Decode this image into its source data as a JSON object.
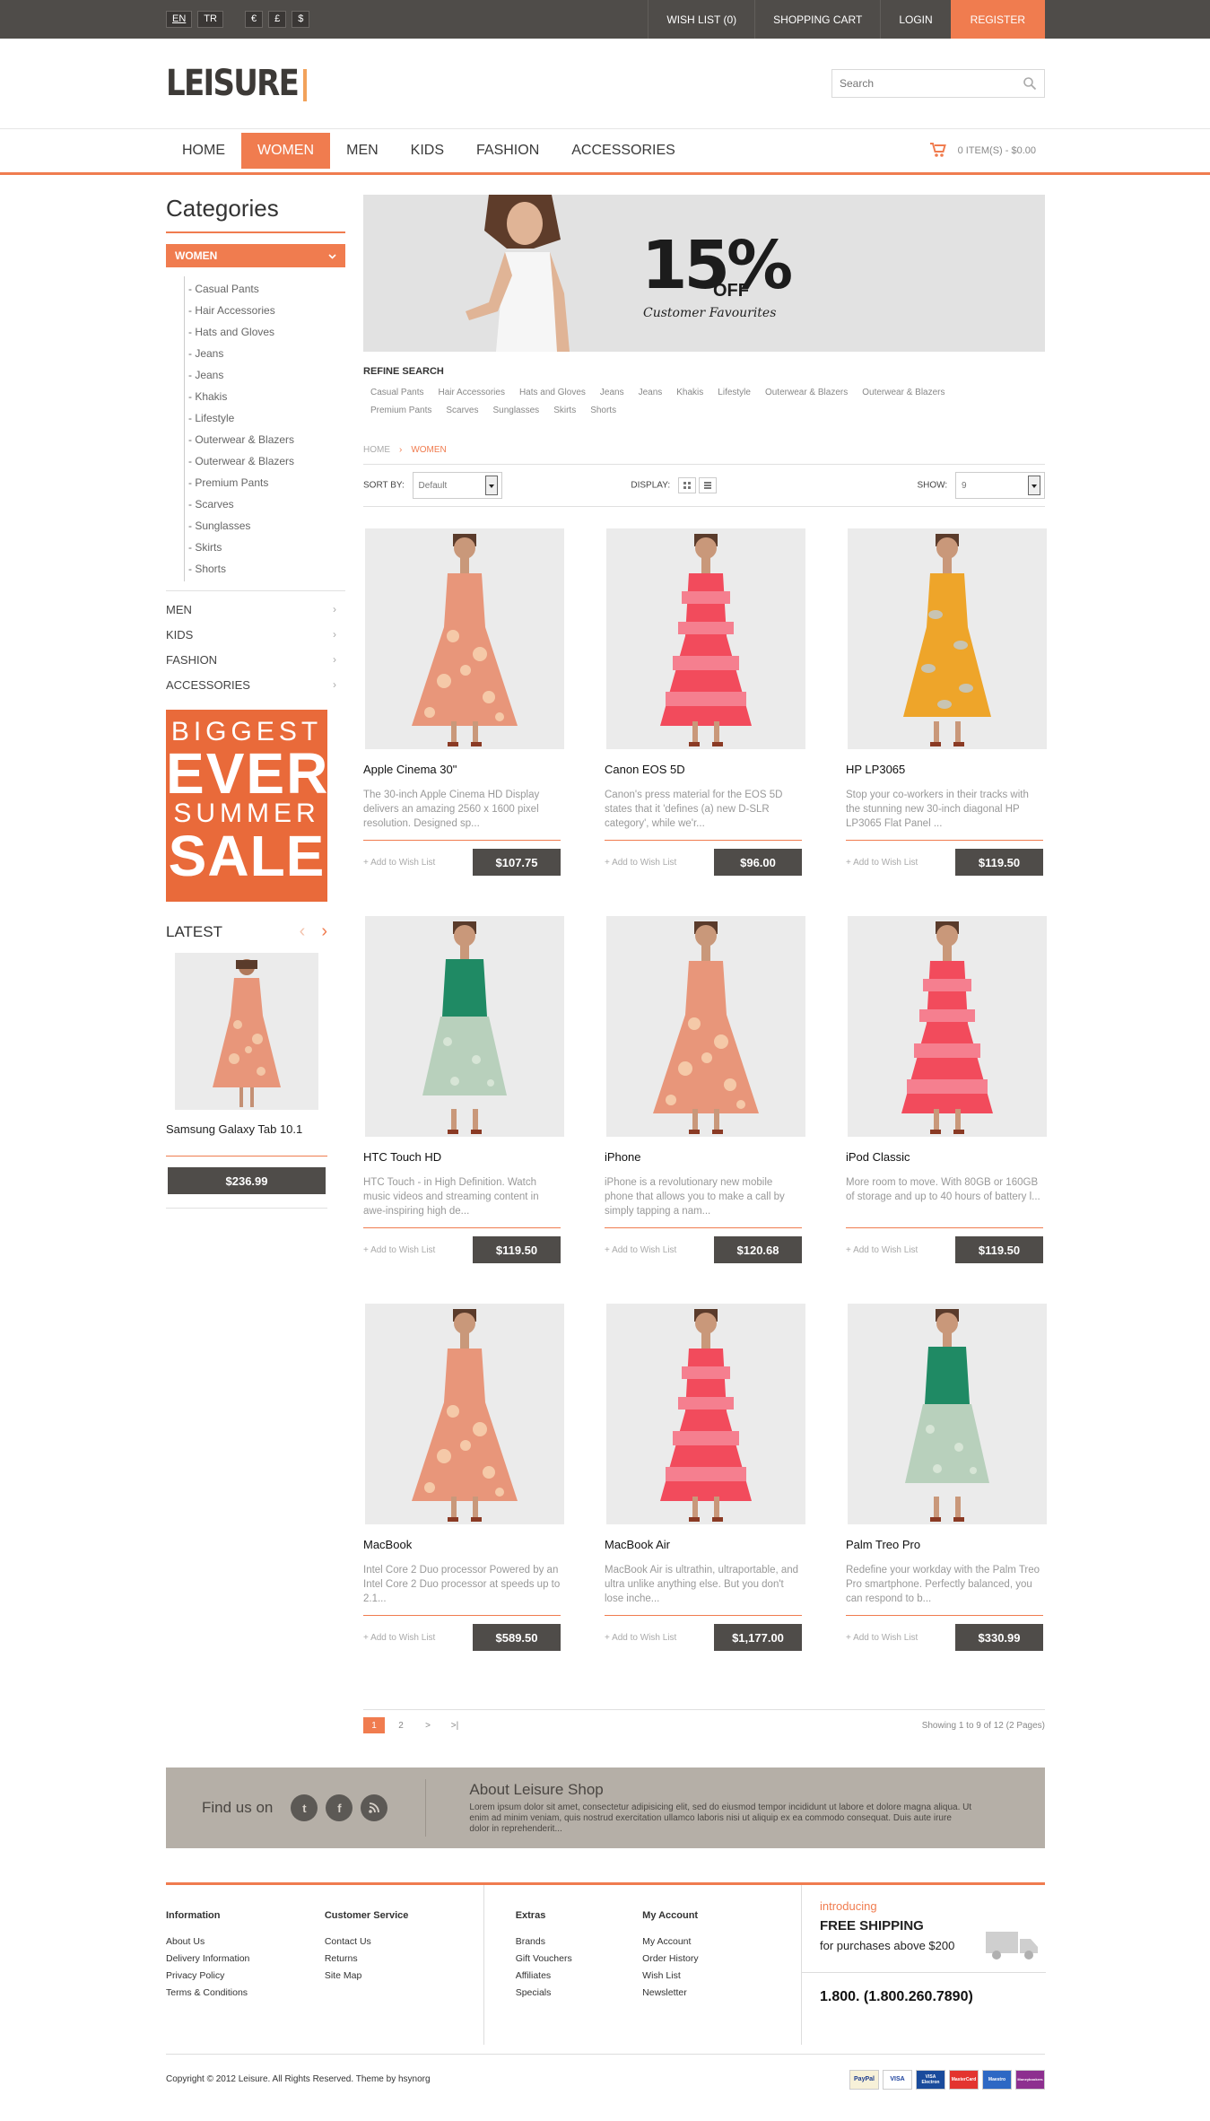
{
  "topbar": {
    "languages": [
      "EN",
      "TR"
    ],
    "currencies": [
      "€",
      "£",
      "$"
    ],
    "links": [
      "WISH LIST (0)",
      "SHOPPING CART",
      "LOGIN",
      "REGISTER"
    ]
  },
  "header": {
    "logo": "LEISURE",
    "search_placeholder": "Search"
  },
  "nav": {
    "items": [
      "HOME",
      "WOMEN",
      "MEN",
      "KIDS",
      "FASHION",
      "ACCESSORIES"
    ],
    "active": "WOMEN",
    "cart_summary": "0 ITEM(S) - $0.00"
  },
  "sidebar": {
    "title": "Categories",
    "active_category": "WOMEN",
    "subcategories": [
      "- Casual Pants",
      "- Hair Accessories",
      "- Hats and Gloves",
      "- Jeans",
      "- Jeans",
      "- Khakis",
      "- Lifestyle",
      "- Outerwear & Blazers",
      "- Outerwear & Blazers",
      "- Premium Pants",
      "- Scarves",
      "- Sunglasses",
      "- Skirts",
      "- Shorts"
    ],
    "categories": [
      "MEN",
      "KIDS",
      "FASHION",
      "ACCESSORIES"
    ],
    "promo": [
      "BIGGEST",
      "EVER",
      "SUMMER",
      "SALE"
    ],
    "latest_title": "LATEST",
    "latest_product": {
      "name": "Samsung Galaxy Tab 10.1",
      "price": "$236.99"
    }
  },
  "banner": {
    "percent": "15%",
    "off": "OFF",
    "caption": "Customer Favourites"
  },
  "refine": {
    "title": "REFINE SEARCH",
    "links": [
      "Casual Pants",
      "Hair Accessories",
      "Hats and Gloves",
      "Jeans",
      "Jeans",
      "Khakis",
      "Lifestyle",
      "Outerwear & Blazers",
      "Outerwear & Blazers",
      "Premium Pants",
      "Scarves",
      "Sunglasses",
      "Skirts",
      "Shorts"
    ]
  },
  "breadcrumb": [
    "HOME",
    "WOMEN"
  ],
  "toolbar": {
    "sort_label": "SORT BY:",
    "sort_value": "Default",
    "display_label": "DISPLAY:",
    "show_label": "SHOW:",
    "show_value": "9"
  },
  "products": [
    {
      "name": "Apple Cinema 30\"",
      "desc": "The 30-inch Apple Cinema HD Display delivers an amazing 2560 x 1600 pixel resolution. Designed sp...",
      "wish": "+ Add to Wish List",
      "price": "$107.75",
      "dress": "floral"
    },
    {
      "name": "Canon EOS 5D",
      "desc": "Canon's press material for the EOS 5D states that it 'defines (a) new D-SLR category', while we'r...",
      "wish": "+ Add to Wish List",
      "price": "$96.00",
      "dress": "pink"
    },
    {
      "name": "HP LP3065",
      "desc": "Stop your co-workers in their tracks with the stunning new 30-inch diagonal HP LP3065 Flat Panel ...",
      "wish": "+ Add to Wish List",
      "price": "$119.50",
      "dress": "yellow"
    },
    {
      "name": "HTC Touch HD",
      "desc": "HTC Touch - in High Definition. Watch music videos and streaming content in awe-inspiring high de...",
      "wish": "+ Add to Wish List",
      "price": "$119.50",
      "dress": "green"
    },
    {
      "name": "iPhone",
      "desc": "iPhone is a revolutionary new mobile phone that allows you to make a call by simply tapping a nam...",
      "wish": "+ Add to Wish List",
      "price": "$120.68",
      "dress": "floral"
    },
    {
      "name": "iPod Classic",
      "desc": "More room to move. With 80GB or 160GB of storage and up to 40 hours of battery l...",
      "wish": "+ Add to Wish List",
      "price": "$119.50",
      "dress": "pink"
    },
    {
      "name": "MacBook",
      "desc": "Intel Core 2 Duo processor Powered by an Intel Core 2 Duo processor at speeds up to 2.1...",
      "wish": "+ Add to Wish List",
      "price": "$589.50",
      "dress": "floral"
    },
    {
      "name": "MacBook Air",
      "desc": "MacBook Air is ultrathin, ultraportable, and ultra unlike anything else. But you don't lose inche...",
      "wish": "+ Add to Wish List",
      "price": "$1,177.00",
      "dress": "pink"
    },
    {
      "name": "Palm Treo Pro",
      "desc": "Redefine your workday with the Palm Treo Pro smartphone. Perfectly balanced, you can respond to b...",
      "wish": "+ Add to Wish List",
      "price": "$330.99",
      "dress": "green"
    }
  ],
  "pagination": {
    "pages": [
      "1",
      "2",
      ">",
      ">|"
    ],
    "current": "1",
    "summary": "Showing 1 to 9 of 12 (2 Pages)"
  },
  "social": {
    "find_us": "Find us on",
    "icons": [
      "twitter-icon",
      "facebook-icon",
      "rss-icon"
    ],
    "about_title": "About Leisure Shop",
    "about_text": "Lorem ipsum dolor sit amet, consectetur adipisicing elit, sed do eiusmod tempor incididunt ut labore et dolore magna aliqua. Ut enim ad minim veniam, quis nostrud exercitation ullamco laboris nisi ut aliquip ex ea commodo consequat. Duis aute irure dolor in reprehenderit..."
  },
  "footer": {
    "columns": [
      {
        "title": "Information",
        "links": [
          "About Us",
          "Delivery Information",
          "Privacy Policy",
          "Terms & Conditions"
        ]
      },
      {
        "title": "Customer Service",
        "links": [
          "Contact Us",
          "Returns",
          "Site Map"
        ]
      },
      {
        "title": "Extras",
        "links": [
          "Brands",
          "Gift Vouchers",
          "Affiliates",
          "Specials"
        ]
      },
      {
        "title": "My Account",
        "links": [
          "My Account",
          "Order History",
          "Wish List",
          "Newsletter"
        ]
      }
    ],
    "shipping": {
      "intro": "introducing",
      "title": "FREE SHIPPING",
      "sub": "for purchases above $200",
      "phone": "1.800. (1.800.260.7890)"
    },
    "copyright": "Copyright © 2012 Leisure. All Rights Reserved. Theme by hsynorg",
    "payment_cards": [
      "PayPal",
      "VISA",
      "VISA Electron",
      "MasterCard",
      "Maestro",
      "Moneybookers"
    ]
  },
  "colors": {
    "accent": "#f07c4f",
    "dark": "#4f4c49",
    "social_bg": "#b5afa7"
  }
}
